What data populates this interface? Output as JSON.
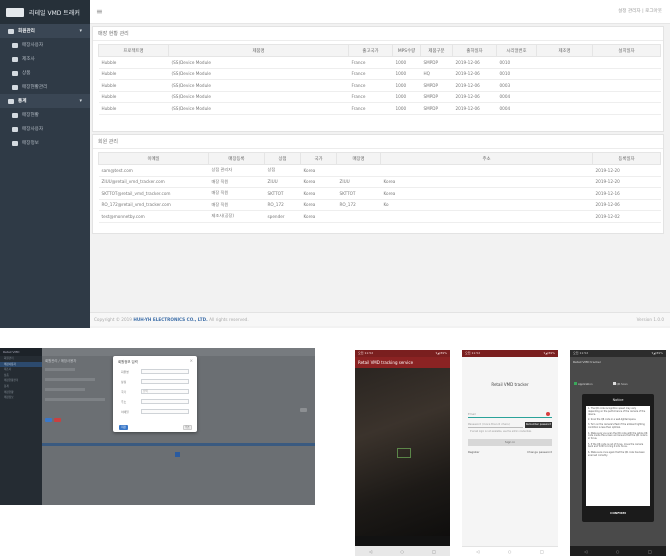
{
  "admin": {
    "brand": "리테일 VMD 트래커",
    "topbar_links": "설정 관리자 | 로그아웃",
    "sidebar": [
      {
        "label": "회원관리",
        "group": true
      },
      {
        "label": "매장사용자",
        "group": false
      },
      {
        "label": "제조사",
        "group": false
      },
      {
        "label": "상품",
        "group": false
      },
      {
        "label": "매장현황관리",
        "group": false
      },
      {
        "label": "통계",
        "group": true
      },
      {
        "label": "매장현황",
        "group": false
      },
      {
        "label": "매장사용자",
        "group": false
      },
      {
        "label": "매장정보",
        "group": false
      }
    ],
    "devices_card": {
      "title": "매장 현황 관리",
      "columns": [
        "프로젝트명",
        "제품명",
        "출고국가",
        "MPS수량",
        "제품구분",
        "출하일자",
        "시리얼번호",
        "제조명",
        "설치일자"
      ],
      "rows": [
        [
          "Hubble",
          "(SS)Device Module",
          "France",
          "1000",
          "SMPDP",
          "2019-12-06",
          "0010",
          "",
          ""
        ],
        [
          "Hubble",
          "(SS)Device Module",
          "France",
          "1000",
          "HQ",
          "2019-12-06",
          "0010",
          "",
          ""
        ],
        [
          "Hubble",
          "(SS)Device Module",
          "France",
          "1000",
          "SMPDP",
          "2019-12-06",
          "0003",
          "",
          ""
        ],
        [
          "Hubble",
          "(SS)Device Module",
          "France",
          "1000",
          "SMPDP",
          "2019-12-06",
          "0004",
          "",
          ""
        ],
        [
          "Hubble",
          "(SS)Device Module",
          "France",
          "1000",
          "SMPDP",
          "2019-12-06",
          "0004",
          "",
          ""
        ]
      ]
    },
    "users_card": {
      "title": "회원 관리",
      "columns": [
        "이메일",
        "매장등록",
        "상점",
        "국가",
        "매장명",
        "주소",
        "등록일자"
      ],
      "rows": [
        [
          "sam@test.com",
          "상점 관리자",
          "상점",
          "Korea",
          "",
          "",
          "2019-12-20"
        ],
        [
          "ZIUU@retail_vmd_tracker.com",
          "매장 직원",
          "ZIUU",
          "Korea",
          "ZIUU",
          "Korea",
          "2019-12-20"
        ],
        [
          "SKTTOT@retail_vmd_tracker.com",
          "매장 직원",
          "SKTTOT",
          "Korea",
          "SKTTOT",
          "Korea",
          "2019-12-16"
        ],
        [
          "RO_172@retail_vmd_tracker.com",
          "매장 직원",
          "RO_172",
          "Korea",
          "RO_172",
          "Ko",
          "2019-12-06"
        ],
        [
          "test@monnetby.com",
          "제조사(공장)",
          "spender",
          "Korea",
          "",
          "",
          "2019-12-02"
        ]
      ]
    },
    "footer_prefix": "Copyright © 2019",
    "footer_company": "HUH-YH ELECTRONICS CO., LTD.",
    "footer_suffix": "All rights reserved.",
    "footer_version": "Version 1.0.0"
  },
  "modal_screen": {
    "brand": "Retail VMD",
    "menu": [
      "회원관리",
      "매장사용자",
      "제조사",
      "상품",
      "매장현황관리",
      "통계",
      "매장현황",
      "매장정보"
    ],
    "page_title": "회원관리 / 매장사용자",
    "modal_title": "회원정보 입력",
    "fields": [
      {
        "label": "회원명",
        "value": ""
      },
      {
        "label": "상점",
        "value": ""
      },
      {
        "label": "국가",
        "value": "선택"
      },
      {
        "label": "주소",
        "value": ""
      },
      {
        "label": "이메일",
        "value": ""
      }
    ],
    "save_label": "저장",
    "cancel_label": "취소"
  },
  "phone_camera": {
    "status_time": "오전 11:52",
    "status_right": "▾◢ 89%",
    "header": "Retail VMD tracking service",
    "nav": [
      "◁",
      "○",
      "□"
    ]
  },
  "phone_login": {
    "status_time": "오전 11:52",
    "status_right": "▾◢ 89%",
    "title": "Retail VMD tracker",
    "email_placeholder": "Email",
    "password_placeholder": "Password (more than 6 chars)",
    "remember_label": "Remember password",
    "hint": "If email login is not available, use the admin credentials",
    "signin_label": "Sign in",
    "register_label": "Register",
    "change_password_label": "Change password",
    "nav": [
      "◁",
      "○",
      "□"
    ]
  },
  "phone_notice": {
    "status_time": "오전 11:52",
    "status_right": "▾◢ 89%",
    "header": "Retail VMD tracker",
    "check_a": "Application",
    "check_b": "QR Scan",
    "dialog_title": "Notice",
    "steps": [
      "1. The QR code recognition speed may vary depending on the performance of the camera of the device.",
      "2. Scan the QR code in a well-lighted space.",
      "3. Turn on the camera's flash if the ambient lighting condition is less than optimal.",
      "4. Make sure you scan the QR code with the whole QR code inside the screen and ensure that the QR code is in focus.",
      "5. If the QR code is out of focus, move the camera back and forth to bring it into focus.",
      "6. Make sure once again that the QR code has been scanned correctly."
    ],
    "confirm_label": "CONFIRM",
    "nav": [
      "◁",
      "○",
      "□"
    ]
  },
  "colors": {
    "sidebar": "#2f3a46",
    "app_header_red": "#8b2323",
    "primary_blue": "#3a78c9"
  }
}
